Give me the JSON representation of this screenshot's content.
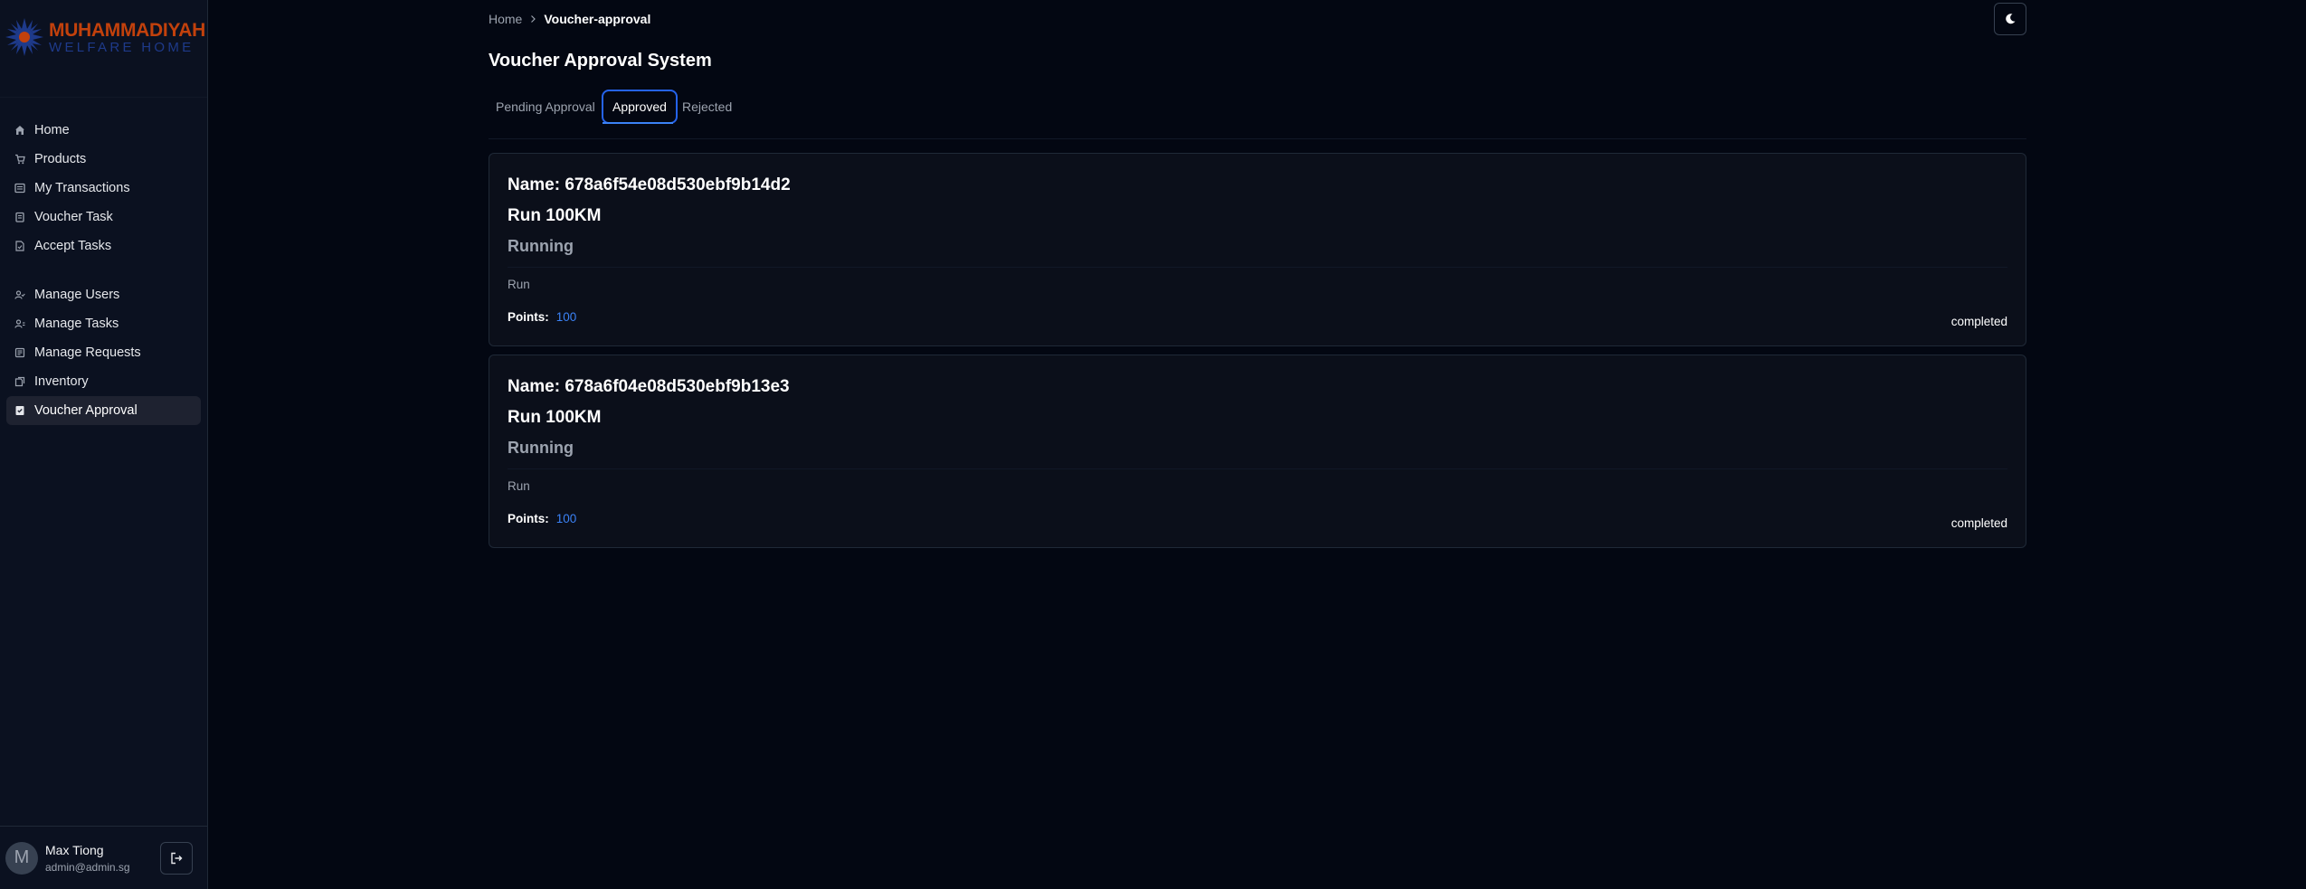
{
  "brand": {
    "line1": "MUHAMMADIYAH",
    "line2": "WELFARE HOME",
    "primary_color": "#c2410c",
    "secondary_color": "#1e3a8a"
  },
  "sidebar": {
    "group1": [
      {
        "label": "Home",
        "icon": "home-icon"
      },
      {
        "label": "Products",
        "icon": "cart-icon"
      },
      {
        "label": "My Transactions",
        "icon": "receipt-icon"
      },
      {
        "label": "Voucher Task",
        "icon": "clipboard-icon"
      },
      {
        "label": "Accept Tasks",
        "icon": "file-check-icon"
      }
    ],
    "group2": [
      {
        "label": "Manage Users",
        "icon": "users-icon"
      },
      {
        "label": "Manage Tasks",
        "icon": "user-tasks-icon"
      },
      {
        "label": "Manage Requests",
        "icon": "inbox-icon"
      },
      {
        "label": "Inventory",
        "icon": "box-icon"
      },
      {
        "label": "Voucher Approval",
        "icon": "clipboard-check-icon",
        "active": true
      }
    ]
  },
  "user": {
    "avatar_initial": "M",
    "name": "Max Tiong",
    "email": "admin@admin.sg"
  },
  "breadcrumb": {
    "home": "Home",
    "current": "Voucher-approval"
  },
  "page": {
    "title": "Voucher Approval System"
  },
  "tabs": [
    {
      "label": "Pending Approval",
      "active": false
    },
    {
      "label": "Approved",
      "active": true
    },
    {
      "label": "Rejected",
      "active": false
    }
  ],
  "vouchers": [
    {
      "name": "Name: 678a6f54e08d530ebf9b14d2",
      "title": "Run 100KM",
      "category": "Running",
      "description": "Run",
      "points_label": "Points:",
      "points_value": "100",
      "status": "completed"
    },
    {
      "name": "Name: 678a6f04e08d530ebf9b13e3",
      "title": "Run 100KM",
      "category": "Running",
      "description": "Run",
      "points_label": "Points:",
      "points_value": "100",
      "status": "completed"
    }
  ],
  "colors": {
    "background": "#030712",
    "accent": "#3b82f6",
    "muted_text": "#9ca3af"
  }
}
